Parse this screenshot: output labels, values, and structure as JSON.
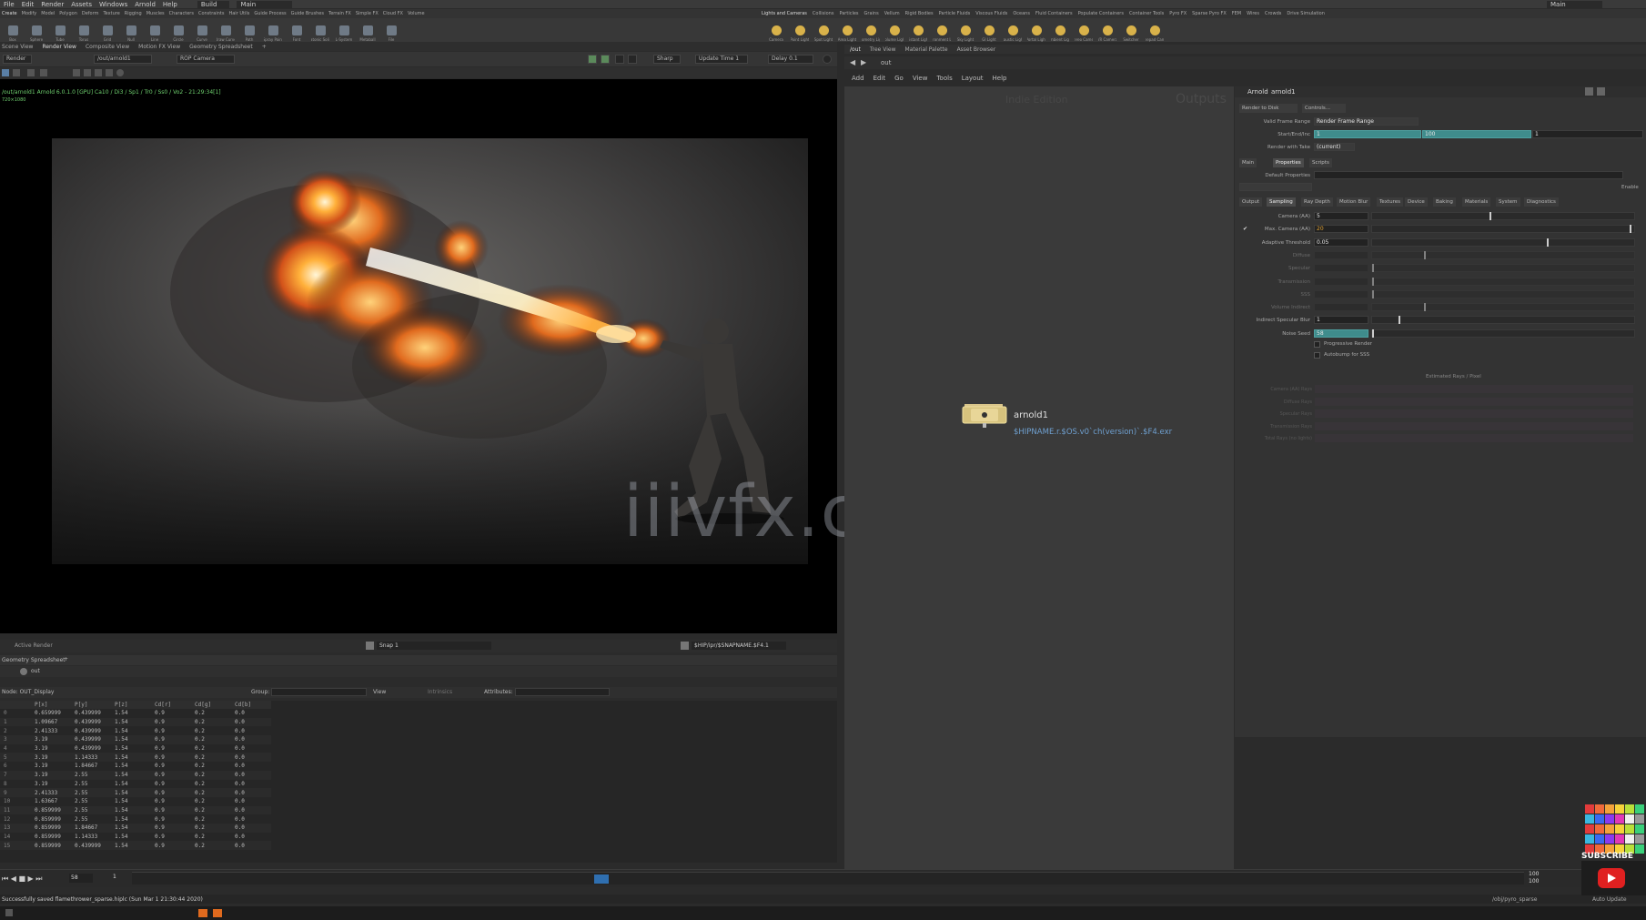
{
  "menu": [
    "File",
    "Edit",
    "Render",
    "Assets",
    "Windows",
    "Arnold",
    "Help"
  ],
  "desktop": "Build",
  "desktop_right": "Main",
  "shelf_tabs_left": [
    "Create",
    "Modify",
    "Model",
    "Polygon",
    "Deform",
    "Texture",
    "Rigging",
    "Muscles",
    "Characters",
    "Constraints",
    "Hair Utils",
    "Guide Process",
    "Guide Brushes",
    "Terrain FX",
    "Simple FX",
    "Cloud FX",
    "Volume"
  ],
  "shelf_tools_left": [
    "Box",
    "Sphere",
    "Tube",
    "Torus",
    "Grid",
    "Null",
    "Line",
    "Circle",
    "Curve",
    "Draw Curve",
    "Path",
    "Spray Paint",
    "Font",
    "Platonic Solids",
    "L-System",
    "Metaball",
    "File"
  ],
  "shelf_tabs_right": [
    "Lights and Cameras",
    "Collisions",
    "Particles",
    "Grains",
    "Vellum",
    "Rigid Bodies",
    "Particle Fluids",
    "Viscous Fluids",
    "Oceans",
    "Fluid Containers",
    "Populate Containers",
    "Container Tools",
    "Pyro FX",
    "Sparse Pyro FX",
    "FEM",
    "Wires",
    "Crowds",
    "Drive Simulation"
  ],
  "shelf_tools_right": [
    "Camera",
    "Point Light",
    "Spot Light",
    "Area Light",
    "Geometry Light",
    "Volume Light",
    "Distant Light",
    "Environment Light",
    "Sky Light",
    "GI Light",
    "Caustic Light",
    "Portal Light",
    "Ambient Light",
    "Stereo Camera",
    "VR Camera",
    "Switcher",
    "Gamepad Camera"
  ],
  "left_tabs": [
    "Scene View",
    "Render View",
    "Composite View",
    "Motion FX View",
    "Geometry Spreadsheet"
  ],
  "left_active_tab": "Render View",
  "render_toolbar": {
    "render_btn": "Render",
    "rop": "/out/arnold1",
    "camera": "ROP Camera",
    "mode": "Sharp",
    "update_time": "Update Time  1",
    "delay": "Delay  0.1"
  },
  "viewport": {
    "status": "/out/arnold1  Arnold 6.0.1.0 [GPU]  Ca10 / Di3 / Sp1 / Tr0 / Ss0 / Vo2 - 21:29:34[1]",
    "resolution": "720×1080",
    "watermark": "iiivfx.com"
  },
  "viewport_bottom": {
    "left": "Active Render",
    "snap": "Snap  1",
    "path": "$HIP/ipr/$SNAPNAME.$F4.1"
  },
  "spreadsheet": {
    "tab": "Geometry Spreadsheet",
    "path": "out",
    "node": "Node: OUT_Display",
    "group_label": "Group:",
    "view_label": "View",
    "intrinsics_label": "Intrinsics",
    "attributes_label": "Attributes:",
    "columns": [
      "",
      "P[x]",
      "P[y]",
      "P[z]",
      "Cd[r]",
      "Cd[g]",
      "Cd[b]"
    ],
    "rows": [
      [
        "0",
        "0.659999",
        "0.439999",
        "1.54",
        "0.9",
        "0.2",
        "0.0"
      ],
      [
        "1",
        "1.09667",
        "0.439999",
        "1.54",
        "0.9",
        "0.2",
        "0.0"
      ],
      [
        "2",
        "2.41333",
        "0.439999",
        "1.54",
        "0.9",
        "0.2",
        "0.0"
      ],
      [
        "3",
        "3.19",
        "0.439999",
        "1.54",
        "0.9",
        "0.2",
        "0.0"
      ],
      [
        "4",
        "3.19",
        "0.439999",
        "1.54",
        "0.9",
        "0.2",
        "0.0"
      ],
      [
        "5",
        "3.19",
        "1.14333",
        "1.54",
        "0.9",
        "0.2",
        "0.0"
      ],
      [
        "6",
        "3.19",
        "1.84667",
        "1.54",
        "0.9",
        "0.2",
        "0.0"
      ],
      [
        "7",
        "3.19",
        "2.55",
        "1.54",
        "0.9",
        "0.2",
        "0.0"
      ],
      [
        "8",
        "3.19",
        "2.55",
        "1.54",
        "0.9",
        "0.2",
        "0.0"
      ],
      [
        "9",
        "2.41333",
        "2.55",
        "1.54",
        "0.9",
        "0.2",
        "0.0"
      ],
      [
        "10",
        "1.63667",
        "2.55",
        "1.54",
        "0.9",
        "0.2",
        "0.0"
      ],
      [
        "11",
        "0.859999",
        "2.55",
        "1.54",
        "0.9",
        "0.2",
        "0.0"
      ],
      [
        "12",
        "0.859999",
        "2.55",
        "1.54",
        "0.9",
        "0.2",
        "0.0"
      ],
      [
        "13",
        "0.859999",
        "1.84667",
        "1.54",
        "0.9",
        "0.2",
        "0.0"
      ],
      [
        "14",
        "0.859999",
        "1.14333",
        "1.54",
        "0.9",
        "0.2",
        "0.0"
      ],
      [
        "15",
        "0.859999",
        "0.439999",
        "1.54",
        "0.9",
        "0.2",
        "0.0"
      ]
    ]
  },
  "timeline": {
    "frame": "58",
    "start": "1",
    "end": "100",
    "end2": "100"
  },
  "statusbar": "Successfully saved flamethrower_sparse.hiplc (Sun Mar 1 21:30:44 2020)",
  "statusbar_right": "/obj/pyro_sparse",
  "auto_update": "Auto Update",
  "network": {
    "tabs": [
      "/out",
      "Tree View",
      "Material Palette",
      "Asset Browser"
    ],
    "path": "out",
    "menu": [
      "Add",
      "Edit",
      "Go",
      "View",
      "Tools",
      "Layout",
      "Help"
    ],
    "caption": "Indie Edition",
    "context_label": "Outputs",
    "node_name": "arnold1",
    "node_output": "$HIPNAME.r.$OS.v0`ch(version)`.$F4.exr"
  },
  "params": {
    "type": "Arnold",
    "name": "arnold1",
    "render_to_disk": "Render to Disk",
    "controls": "Controls...",
    "valid_frame_range_label": "Valid Frame Range",
    "valid_frame_range": "Render Frame Range",
    "start_end_inc_label": "Start/End/Inc",
    "start": "1",
    "end": "100",
    "inc": "1",
    "render_with_take_label": "Render with Take",
    "take": "(current)",
    "tabs1": [
      "Main",
      "Properties",
      "Scripts"
    ],
    "default_props_label": "Default Properties",
    "enable_label": "Enable",
    "tabs2": [
      "Output",
      "Sampling",
      "Ray Depth",
      "Motion Blur",
      "Textures",
      "Device",
      "Baking",
      "Materials",
      "System",
      "Diagnostics"
    ],
    "sampling": [
      {
        "label": "Camera (AA)",
        "value": "5",
        "slider": 0.45,
        "dim": false
      },
      {
        "label": "Max. Camera (AA)",
        "value": "20",
        "slider": 0.99,
        "dim": false
      },
      {
        "label": "Adaptive Threshold",
        "value": "0.05",
        "slider": 0.67,
        "dim": false
      },
      {
        "label": "Diffuse",
        "value": "",
        "slider": 0.2,
        "dim": true
      },
      {
        "label": "Specular",
        "value": "",
        "slider": 0.0,
        "dim": true
      },
      {
        "label": "Transmission",
        "value": "",
        "slider": 0.0,
        "dim": true
      },
      {
        "label": "SSS",
        "value": "",
        "slider": 0.0,
        "dim": true
      },
      {
        "label": "Volume Indirect",
        "value": "",
        "slider": 0.2,
        "dim": true
      },
      {
        "label": "Indirect Specular Blur",
        "value": "1",
        "slider": 0.1,
        "dim": false
      },
      {
        "label": "Noise Seed",
        "value": "58",
        "slider": 0.0,
        "dim": false
      }
    ],
    "progressive_render": "Progressive Render",
    "autobump_sss": "Autobump for SSS",
    "estimated_title": "Estimated Rays / Pixel",
    "estimated_rows": [
      "Camera (AA) Rays",
      "Diffuse Rays",
      "Specular Rays",
      "Transmission Rays",
      "Total Rays (no lights)"
    ]
  },
  "subscribe": "SUBSCRIBE"
}
